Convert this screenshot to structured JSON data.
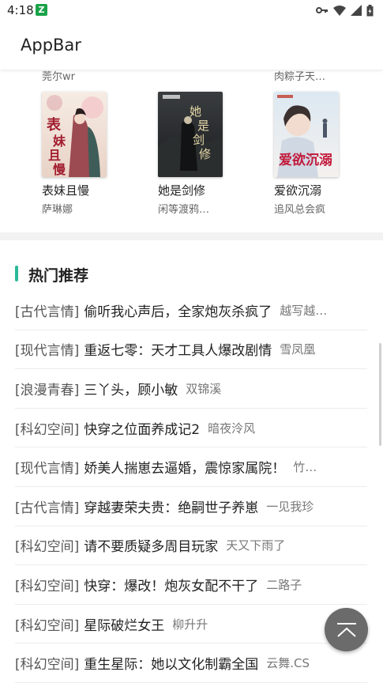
{
  "status_bar": {
    "time": "4:18",
    "app_icon": "green-app-notification-icon",
    "icons": [
      "key-icon",
      "wifi-icon",
      "signal-icon",
      "battery-icon"
    ]
  },
  "app_bar": {
    "title": "AppBar"
  },
  "partial_row": {
    "authors": [
      "莞尔wr",
      "肉粽子天…"
    ]
  },
  "books": [
    {
      "title": "表妹且慢",
      "author": "萨琳娜",
      "cover_text": "表妹且慢"
    },
    {
      "title": "她是剑修",
      "author": "闲等渡鸦…",
      "cover_text": "她是剑修"
    },
    {
      "title": "爱欲沉溺",
      "author": "追风总会疯",
      "cover_text": "爱欲沉溺"
    }
  ],
  "section": {
    "title": "热门推荐",
    "accent_color": "#29b999"
  },
  "recommendations": [
    {
      "category": "[古代言情]",
      "title": "偷听我心声后，全家炮灰杀疯了",
      "author": "越写越…"
    },
    {
      "category": "[现代言情]",
      "title": "重返七零：天才工具人爆改剧情",
      "author": "雪凤凰"
    },
    {
      "category": "[浪漫青春]",
      "title": "三丫头，顾小敏",
      "author": "双锦溪"
    },
    {
      "category": "[科幻空间]",
      "title": "快穿之位面养成记2",
      "author": "暗夜泠风"
    },
    {
      "category": "[现代言情]",
      "title": "娇美人揣崽去逼婚，震惊家属院！",
      "author": "竹…"
    },
    {
      "category": "[古代言情]",
      "title": "穿越妻荣夫贵：绝嗣世子养崽",
      "author": "一见我珍"
    },
    {
      "category": "[科幻空间]",
      "title": "请不要质疑多周目玩家",
      "author": "天又下雨了"
    },
    {
      "category": "[科幻空间]",
      "title": "快穿：爆改！炮灰女配不干了",
      "author": "二路子"
    },
    {
      "category": "[科幻空间]",
      "title": "星际破烂女王",
      "author": "柳升升"
    },
    {
      "category": "[科幻空间]",
      "title": "重生星际：她以文化制霸全国",
      "author": "云舞.CS"
    }
  ],
  "fab": {
    "icon": "scroll-to-top-icon"
  }
}
